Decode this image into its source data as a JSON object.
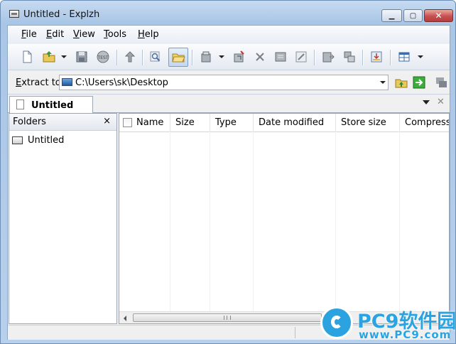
{
  "window": {
    "title": "Untitled - Explzh"
  },
  "menubar": {
    "items": [
      {
        "label": "File",
        "key": "F"
      },
      {
        "label": "Edit",
        "key": "E"
      },
      {
        "label": "View",
        "key": "V"
      },
      {
        "label": "Tools",
        "key": "T"
      },
      {
        "label": "Help",
        "key": "H"
      }
    ]
  },
  "toolbar": {
    "buttons": [
      "new-archive-icon",
      "open-archive-icon",
      "save-icon",
      "test-archive-icon",
      "move-up-icon",
      "find-icon",
      "open-folder-icon",
      "add-files-icon",
      "extract-icon",
      "delete-icon",
      "rename-icon",
      "properties-icon",
      "convert-icon",
      "split-icon",
      "self-extract-icon",
      "view-mode-icon"
    ]
  },
  "extract": {
    "label": "Extract to",
    "label_key": "E",
    "path": "C:\\Users\\sk\\Desktop"
  },
  "tabs": [
    {
      "label": "Untitled",
      "active": true
    }
  ],
  "folders": {
    "title": "Folders",
    "close": "×",
    "items": [
      {
        "label": "Untitled"
      }
    ]
  },
  "list": {
    "columns": [
      "Name",
      "Size",
      "Type",
      "Date modified",
      "Store size",
      "Compress r"
    ],
    "rows": []
  },
  "watermark": {
    "title": "PC9软件园",
    "url": "www.PC9.com"
  },
  "colors": {
    "accent": "#2aa3e0",
    "title_bar": "#b9d1ec",
    "close_button": "#c75050"
  }
}
